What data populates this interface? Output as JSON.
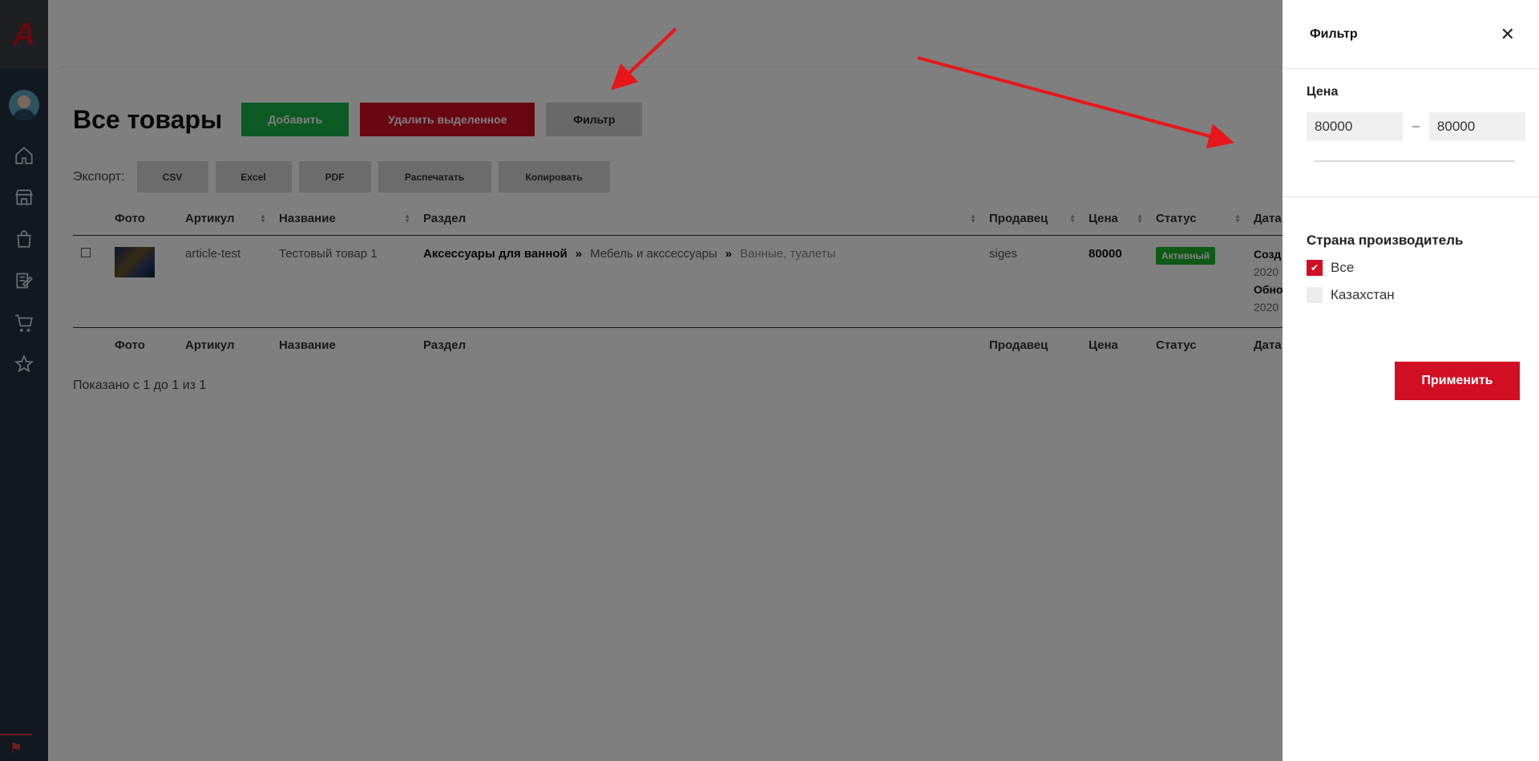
{
  "sidebar": {
    "logo_letter": "A",
    "icons": [
      "home-icon",
      "store-icon",
      "bag-icon",
      "edit-icon",
      "cart-icon",
      "star-icon"
    ]
  },
  "page": {
    "title": "Все товары",
    "add_label": "Добавить",
    "delete_label": "Удалить выделенное",
    "filter_label": "Фильтр",
    "export_label": "Экспорт:",
    "export_buttons": [
      "CSV",
      "Excel",
      "PDF",
      "Распечатать",
      "Копировать"
    ],
    "shown_text": "Показано с 1 до 1 из 1"
  },
  "table": {
    "columns": [
      "Фото",
      "Артикул",
      "Название",
      "Раздел",
      "Продавец",
      "Цена",
      "Статус",
      "Дата"
    ],
    "rows": [
      {
        "article": "article-test",
        "name": "Тестовый товар 1",
        "section_main": "Аксессуары для ванной",
        "section_sub": "Мебель и акссессуары",
        "section_sub2": "Ванные, туалеты",
        "seller": "siges",
        "price": "80000",
        "status": "Активный",
        "created_label": "Созд",
        "created_val": "2020",
        "updated_label": "Обно",
        "updated_val": "2020"
      }
    ]
  },
  "filter_panel": {
    "title": "Фильтр",
    "price_label": "Цена",
    "price_min": "80000",
    "price_max": "80000",
    "dash": "–",
    "country_label": "Страна производитель",
    "options": [
      {
        "label": "Все",
        "checked": true
      },
      {
        "label": "Казахстан",
        "checked": false
      }
    ],
    "apply_label": "Применить"
  },
  "colors": {
    "accent_red": "#d10f22",
    "accent_green": "#1bb347",
    "sidebar_bg": "#25303e"
  }
}
